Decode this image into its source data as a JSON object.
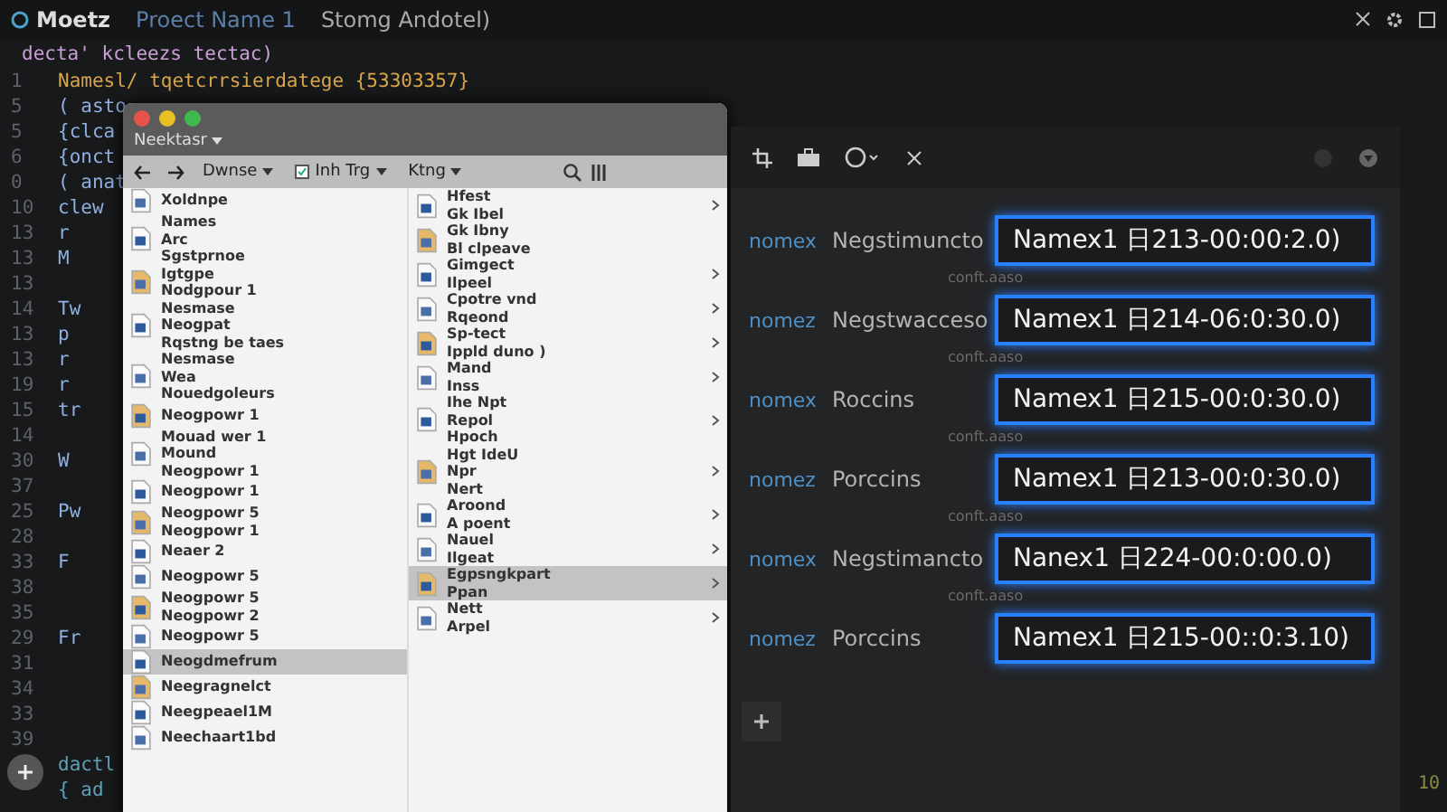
{
  "editor": {
    "app_name": "Moetz",
    "project": "Proect Name 1",
    "branch": "Stomg Andotel)",
    "header": "decta' kcleezs tectac)",
    "lines": [
      {
        "number": "1",
        "code": "Namesl/ tqetcrrsierdatege {53303357}"
      },
      {
        "number": "5",
        "code": "( asto"
      },
      {
        "number": "5",
        "code": "{clca"
      },
      {
        "number": "6",
        "code": "{onct"
      },
      {
        "number": "0",
        "code": "( anat"
      },
      {
        "number": "10",
        "code": "clew"
      },
      {
        "number": "13",
        "code": "r"
      },
      {
        "number": "13",
        "code": "M"
      },
      {
        "number": "13"
      },
      {
        "number": "14",
        "code": "Tw"
      },
      {
        "number": "13",
        "code": "p"
      },
      {
        "number": "13",
        "code": "r"
      },
      {
        "number": "19",
        "code": "r"
      },
      {
        "number": "15",
        "code": "tr"
      },
      {
        "number": "14"
      },
      {
        "number": "30",
        "code": "W"
      },
      {
        "number": "37"
      },
      {
        "number": "25",
        "code": "Pw"
      },
      {
        "number": "28"
      },
      {
        "number": "33",
        "code": "F"
      },
      {
        "number": "38"
      },
      {
        "number": "35"
      },
      {
        "number": "29",
        "code": "Fr"
      },
      {
        "number": "31"
      },
      {
        "number": "34"
      },
      {
        "number": "33"
      },
      {
        "number": "39"
      }
    ],
    "footer_lines": [
      "dactl",
      "{ ad"
    ],
    "corner_text": "10"
  },
  "finder": {
    "title": "Neektasr",
    "menus": [
      {
        "label": "Dwnse",
        "kind": "plain"
      },
      {
        "label": "Inh Trg",
        "kind": "check"
      },
      {
        "label": "Ktng",
        "kind": "plain"
      }
    ],
    "left_items": [
      {
        "lines": [
          "Xoldnpe"
        ],
        "selected": false
      },
      {
        "lines": [
          "Names",
          "Arc",
          "Sgstprnoe"
        ],
        "selected": false
      },
      {
        "lines": [
          "Igtgpe",
          "Nodgpour 1"
        ],
        "selected": false
      },
      {
        "lines": [
          "Nesmase",
          "Neogpat",
          "Rqstng be taes"
        ],
        "selected": false
      },
      {
        "lines": [
          "Nesmase",
          "Wea",
          "Nouedgoleurs"
        ],
        "selected": false
      },
      {
        "lines": [
          "Neogpowr 1"
        ],
        "selected": false
      },
      {
        "lines": [
          "Mouad wer 1",
          "Mound",
          "Neogpowr 1"
        ],
        "selected": false
      },
      {
        "lines": [
          "Neogpowr 1"
        ],
        "selected": false
      },
      {
        "lines": [
          "Neogpowr 5",
          "Neogpowr 1"
        ],
        "selected": false
      },
      {
        "lines": [
          "Neaer 2"
        ],
        "selected": false
      },
      {
        "lines": [
          "Neogpowr 5"
        ],
        "selected": false
      },
      {
        "lines": [
          "Neogpowr 5",
          "Neogpowr 2"
        ],
        "selected": false
      },
      {
        "lines": [
          "Neogpowr 5"
        ],
        "selected": false
      },
      {
        "lines": [
          "Neogdmefrum"
        ],
        "selected": true
      },
      {
        "lines": [
          "Neegragnelct"
        ],
        "selected": false
      },
      {
        "lines": [
          "Neegpeael1M"
        ],
        "selected": false
      },
      {
        "lines": [
          "Neechaart1bd"
        ],
        "selected": false
      }
    ],
    "right_items": [
      {
        "lines": [
          "Hfest",
          "Gk Ibel"
        ],
        "chevron": true,
        "selected": false
      },
      {
        "lines": [
          "Gk Ibny",
          "Bl clpeave"
        ],
        "chevron": false,
        "selected": false
      },
      {
        "lines": [
          "Gimgect",
          "Ilpeel"
        ],
        "chevron": true,
        "selected": false
      },
      {
        "lines": [
          "Cpotre vnd",
          "Rqeond"
        ],
        "chevron": true,
        "selected": false
      },
      {
        "lines": [
          "Sp-tect",
          "Ippld duno )"
        ],
        "chevron": true,
        "selected": false
      },
      {
        "lines": [
          "Mand",
          "Inss"
        ],
        "chevron": true,
        "selected": false
      },
      {
        "lines": [
          "Ihe Npt",
          "Repol",
          "Hpoch"
        ],
        "chevron": true,
        "selected": false
      },
      {
        "lines": [
          "Hgt IdeU",
          "Npr",
          "Nert"
        ],
        "chevron": true,
        "selected": false
      },
      {
        "lines": [
          "Aroond",
          "A poent"
        ],
        "chevron": true,
        "selected": false
      },
      {
        "lines": [
          "Nauel",
          "Ilgeat"
        ],
        "chevron": true,
        "selected": false
      },
      {
        "lines": [
          "Egpsngkpart",
          "Ppan"
        ],
        "chevron": true,
        "selected": true
      },
      {
        "lines": [
          "Nett",
          "Arpel"
        ],
        "chevron": true,
        "selected": false
      }
    ]
  },
  "panel": {
    "rows": [
      {
        "label": "nomex",
        "name": "Negstimuncto",
        "value": "Namex1 日213-00:00:2.0)",
        "caption": "conft.aaso"
      },
      {
        "label": "nomez",
        "name": "Negstwacceso",
        "value": "Namex1 日214-06:0:30.0)",
        "caption": "conft.aaso"
      },
      {
        "label": "nomex",
        "name": "Roccins",
        "value": "Namex1 日215-00:0:30.0)",
        "caption": "conft.aaso"
      },
      {
        "label": "nomez",
        "name": "Porccins",
        "value": "Namex1 日213-00:0:30.0)",
        "caption": "conft.aaso"
      },
      {
        "label": "nomex",
        "name": "Negstimancto",
        "value": "Nanex1 日224-00:0:00.0)",
        "caption": "conft.aaso"
      },
      {
        "label": "nomez",
        "name": "Porccins",
        "value": "Namex1 日215-00::0:3.10)"
      }
    ]
  }
}
